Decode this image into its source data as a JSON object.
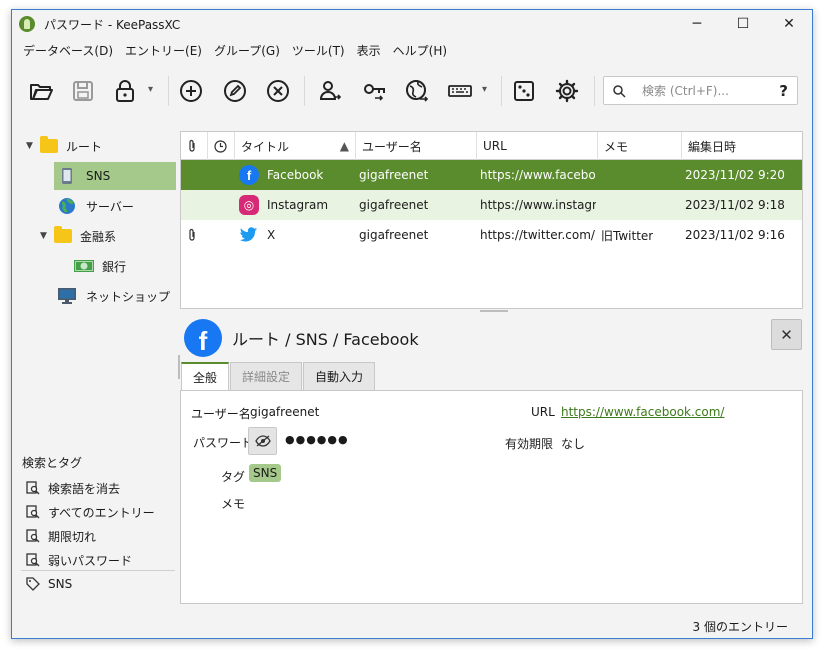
{
  "window": {
    "title": "パスワード - KeePassXC",
    "minimize": "─",
    "maximize": "☐",
    "close": "✕"
  },
  "menu": [
    "データベース(D)",
    "エントリー(E)",
    "グループ(G)",
    "ツール(T)",
    "表示",
    "ヘルプ(H)"
  ],
  "toolbar": {
    "icons": [
      "folder-open-icon",
      "save-icon",
      "lock-icon",
      "add-entry-icon",
      "edit-entry-icon",
      "delete-entry-icon",
      "copy-username-icon",
      "copy-password-icon",
      "open-url-icon",
      "autotype-icon",
      "password-generator-icon",
      "settings-icon"
    ],
    "dropdown": "▾",
    "search_placeholder": "検索 (Ctrl+F)...",
    "search_help": "?"
  },
  "tree": {
    "root": "ルート",
    "items": [
      {
        "label": "SNS",
        "icon": "phone-icon"
      },
      {
        "label": "サーバー",
        "icon": "globe-icon"
      },
      {
        "label": "金融系",
        "icon": "folder-icon"
      },
      {
        "label": "銀行",
        "icon": "money-icon"
      },
      {
        "label": "ネットショップ",
        "icon": "monitor-icon"
      }
    ]
  },
  "tags": {
    "heading": "検索とタグ",
    "items": [
      "検索語を消去",
      "すべてのエントリー",
      "期限切れ",
      "弱いパスワード"
    ],
    "tag": "SNS"
  },
  "table": {
    "columns": [
      "タイトル",
      "ユーザー名",
      "URL",
      "メモ",
      "編集日時"
    ],
    "sort_arrow": "▲",
    "rows": [
      {
        "title": "Facebook",
        "username": "gigafreenet",
        "url": "https://www.facebo...",
        "notes": "",
        "modified": "2023/11/02 9:20",
        "attachment": false,
        "color": "#1877f2",
        "glyph": "f"
      },
      {
        "title": "Instagram",
        "username": "gigafreenet",
        "url": "https://www.instagr...",
        "notes": "",
        "modified": "2023/11/02 9:18",
        "attachment": false,
        "color": "#d62976",
        "glyph": "◎"
      },
      {
        "title": "X",
        "username": "gigafreenet",
        "url": "https://twitter.com/",
        "notes": "旧Twitter",
        "modified": "2023/11/02 9:16",
        "attachment": true,
        "color": "#1d9bf0",
        "glyph": "🐦"
      }
    ]
  },
  "detail": {
    "breadcrumb": "ルート / SNS / Facebook",
    "close": "✕",
    "tabs": [
      "全般",
      "詳細設定",
      "自動入力"
    ],
    "username_label": "ユーザー名",
    "username": "gigafreenet",
    "password_label": "パスワード",
    "password": "●●●●●●",
    "tags_label": "タグ",
    "tag": "SNS",
    "notes_label": "メモ",
    "url_label": "URL",
    "url": "https://www.facebook.com/",
    "expiry_label": "有効期限",
    "expiry": "なし"
  },
  "status": "3 個のエントリー"
}
